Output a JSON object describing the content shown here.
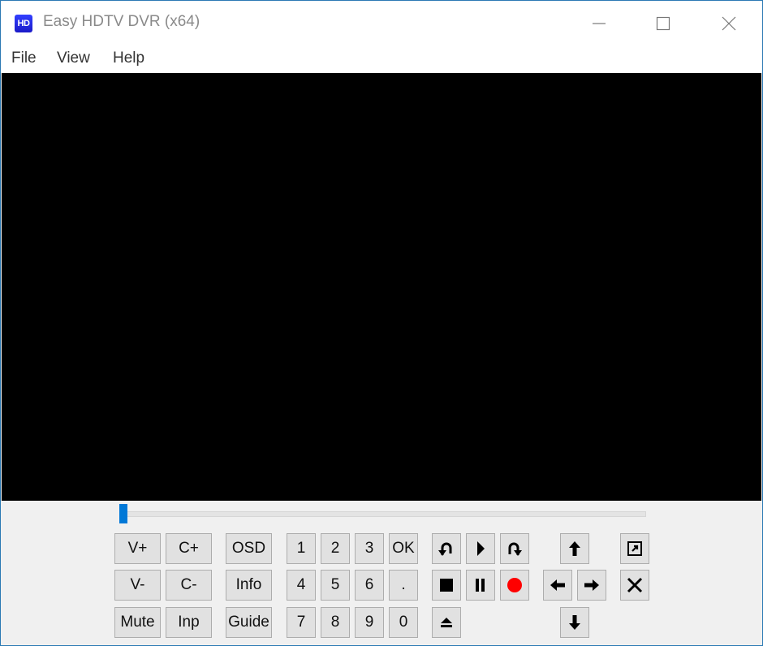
{
  "window": {
    "title": "Easy HDTV DVR (x64)",
    "icon_label": "HD",
    "controls": [
      "minimize",
      "maximize",
      "close"
    ]
  },
  "menu": [
    "File",
    "View",
    "Help"
  ],
  "seek": {
    "position_fraction": 0.0
  },
  "buttons": {
    "v_plus": "V+",
    "c_plus": "C+",
    "osd": "OSD",
    "v_minus": "V-",
    "c_minus": "C-",
    "info": "Info",
    "mute": "Mute",
    "inp": "Inp",
    "guide": "Guide",
    "k1": "1",
    "k2": "2",
    "k3": "3",
    "ok": "OK",
    "k4": "4",
    "k5": "5",
    "k6": "6",
    "dot": ".",
    "k7": "7",
    "k8": "8",
    "k9": "9",
    "k0": "0"
  },
  "icons": {
    "replay": "replay-icon",
    "play": "play-icon",
    "skip": "skip-forward-icon",
    "stop": "stop-icon",
    "pause": "pause-icon",
    "record": "record-icon",
    "eject": "eject-icon",
    "up": "arrow-up-icon",
    "left": "arrow-left-icon",
    "right": "arrow-right-icon",
    "down": "arrow-down-icon",
    "popout": "popout-icon",
    "close": "close-icon"
  },
  "colors": {
    "record": "#ff0000",
    "accent": "#0078d7",
    "border": "#2b79b4"
  }
}
